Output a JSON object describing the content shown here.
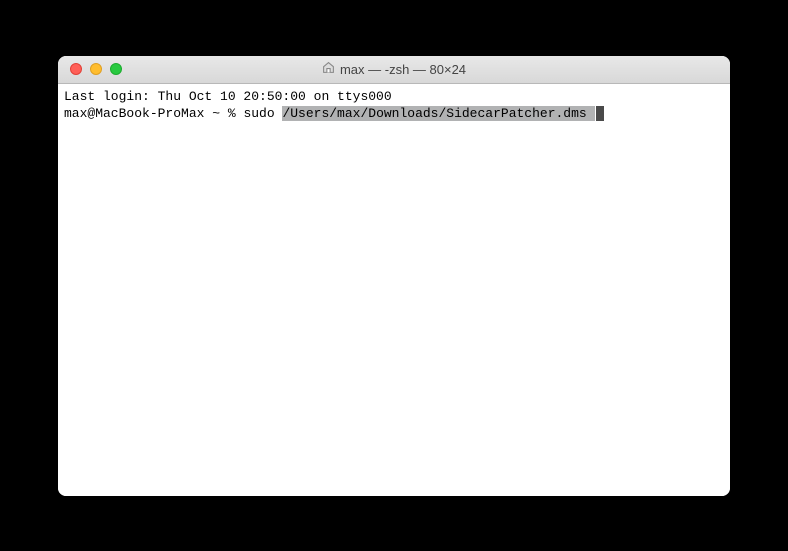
{
  "window": {
    "title": "max — -zsh — 80×24"
  },
  "terminal": {
    "last_login": "Last login: Thu Oct 10 20:50:00 on ttys000",
    "prompt": "max@MacBook-ProMax ~ % ",
    "command_prefix": "sudo ",
    "highlighted_path": "/Users/max/Downloads/SidecarPatcher.dms "
  }
}
